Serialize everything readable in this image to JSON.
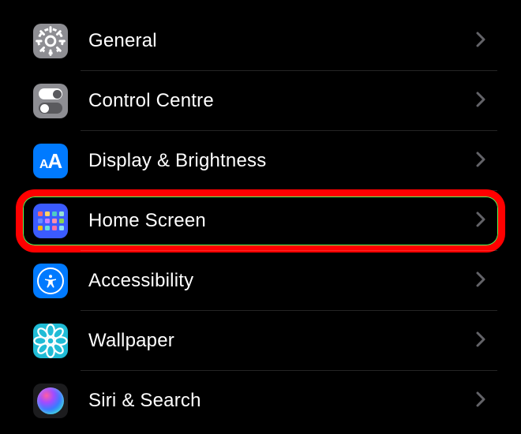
{
  "settings": {
    "items": [
      {
        "id": "general",
        "label": "General",
        "icon": "gear-icon",
        "bg": "bg-gray",
        "highlighted": false
      },
      {
        "id": "control-centre",
        "label": "Control Centre",
        "icon": "control-centre-icon",
        "bg": "bg-gray",
        "highlighted": false
      },
      {
        "id": "display-brightness",
        "label": "Display & Brightness",
        "icon": "text-size-icon",
        "bg": "bg-blue",
        "highlighted": false
      },
      {
        "id": "home-screen",
        "label": "Home Screen",
        "icon": "home-grid-icon",
        "bg": "bg-purple-blue",
        "highlighted": true
      },
      {
        "id": "accessibility",
        "label": "Accessibility",
        "icon": "accessibility-icon",
        "bg": "bg-blue",
        "highlighted": false
      },
      {
        "id": "wallpaper",
        "label": "Wallpaper",
        "icon": "flower-icon",
        "bg": "bg-teal",
        "highlighted": false
      },
      {
        "id": "siri-search",
        "label": "Siri & Search",
        "icon": "siri-icon",
        "bg": "bg-siri",
        "highlighted": false
      }
    ]
  },
  "colors": {
    "highlight_ring": "#ff0000",
    "chevron": "#636368"
  }
}
